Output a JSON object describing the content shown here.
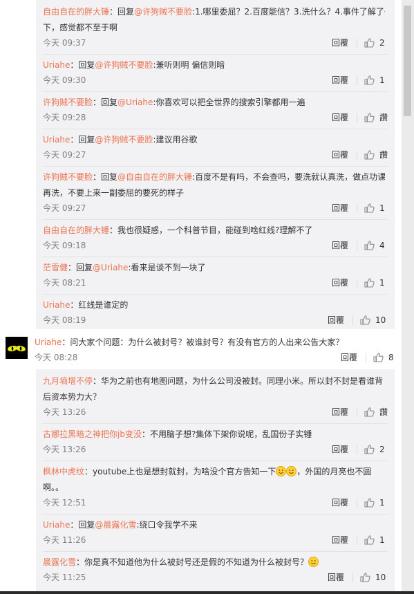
{
  "reply_label": "回覆",
  "replies_top": [
    {
      "lines": [
        [
          {
            "t": "自由自在的胖大锤",
            "u": true
          },
          {
            "t": "：回复"
          },
          {
            "t": "@许狗贼不要脸",
            "u": true
          },
          {
            "t": ":1.哪里委屈？2.百度能信？3.洗什么？4.事件了解了一"
          }
        ],
        [
          {
            "t": "下，感觉都不至于啊"
          }
        ]
      ],
      "time": "今天 09:37",
      "likes": "2"
    },
    {
      "lines": [
        [
          {
            "t": "Uriahe",
            "u": true
          },
          {
            "t": "：回复"
          },
          {
            "t": "@许狗贼不要脸",
            "u": true
          },
          {
            "t": ":兼听则明 偏信则暗"
          }
        ]
      ],
      "time": "今天 09:30",
      "likes": "1"
    },
    {
      "lines": [
        [
          {
            "t": "许狗贼不要脸",
            "u": true
          },
          {
            "t": "：回复"
          },
          {
            "t": "@Uriahe",
            "u": true
          },
          {
            "t": ":你喜欢可以把全世界的搜索引擎都用一遍"
          }
        ]
      ],
      "time": "今天 09:28",
      "likes": "讚"
    },
    {
      "lines": [
        [
          {
            "t": "Uriahe",
            "u": true
          },
          {
            "t": "：回复"
          },
          {
            "t": "@许狗贼不要脸",
            "u": true
          },
          {
            "t": ":建议用谷歌"
          }
        ]
      ],
      "time": "今天 09:27",
      "likes": "讚"
    },
    {
      "lines": [
        [
          {
            "t": "许狗贼不要脸",
            "u": true
          },
          {
            "t": "：回复"
          },
          {
            "t": "@自由自在的胖大锤",
            "u": true
          },
          {
            "t": ":百度不是有吗，不会查吗，要洗就认真洗，做点功课"
          }
        ],
        [
          {
            "t": "再洗，不要上来一副委屈的要死的样子"
          }
        ]
      ],
      "time": "今天 09:27",
      "likes": "1"
    },
    {
      "lines": [
        [
          {
            "t": "自由自在的胖大锤",
            "u": true
          },
          {
            "t": "：我也很疑惑，一个科普节目，能碰到啥红线?理解不了"
          }
        ]
      ],
      "time": "今天 09:18",
      "likes": "4"
    },
    {
      "lines": [
        [
          {
            "t": "茫雪健",
            "u": true
          },
          {
            "t": "：回复"
          },
          {
            "t": "@Uriahe",
            "u": true
          },
          {
            "t": ":看来是谈不到一块了"
          }
        ]
      ],
      "time": "今天 08:21",
      "likes": "1"
    },
    {
      "lines": [
        [
          {
            "t": "Uriahe",
            "u": true
          },
          {
            "t": "：红线是谁定的"
          }
        ]
      ],
      "time": "今天 08:19",
      "likes": "10"
    }
  ],
  "main_comment": {
    "avatar": "cat-eyes-avatar",
    "lines": [
      [
        {
          "t": "Uriahe",
          "u": true
        },
        {
          "t": "：问大家个问题：为什么被封号？被谁封号？有没有官方的人出来公告大家？"
        }
      ]
    ],
    "time": "今天 08:28",
    "likes": "8"
  },
  "replies_bottom": [
    {
      "lines": [
        [
          {
            "t": "九月墒增不停",
            "u": true
          },
          {
            "t": "：华为之前也有地图问题，为什么公司没被封。同理小米。所以封不封是看谁背"
          }
        ],
        [
          {
            "t": "后资本势力大？"
          }
        ]
      ],
      "time": "今天 13:26",
      "likes": "讚"
    },
    {
      "lines": [
        [
          {
            "t": "古娜拉黑暗之神把你jb变没",
            "u": true
          },
          {
            "t": "：不用脑子想?集体下架你说呢，乱国份子实锤"
          }
        ]
      ],
      "time": "今天 13:26",
      "likes": "2"
    },
    {
      "lines": [
        [
          {
            "t": "枫林中虎纹",
            "u": true
          },
          {
            "t": "：youtube上也是想封就封，为啥没个官方告知一下"
          },
          {
            "e": 2
          },
          {
            "t": "，外国的月亮也不圆"
          }
        ],
        [
          {
            "t": "啊。。"
          }
        ]
      ],
      "time": "今天 12:51",
      "likes": "1"
    },
    {
      "lines": [
        [
          {
            "t": "Uriahe",
            "u": true
          },
          {
            "t": "：回复"
          },
          {
            "t": "@晨露化雪",
            "u": true
          },
          {
            "t": ":绕口令我学不来"
          }
        ]
      ],
      "time": "今天 11:26",
      "likes": "1"
    },
    {
      "lines": [
        [
          {
            "t": "晨露化雪",
            "u": true
          },
          {
            "t": "：你是真不知道他为什么被封号还是假的不知道为什么被封号？"
          },
          {
            "e": 1
          }
        ]
      ],
      "time": "今天 11:25",
      "likes": "10"
    }
  ],
  "colors": {
    "username": "#eb7350",
    "meta": "#808080",
    "reply_bg": "#f2f2f5"
  }
}
